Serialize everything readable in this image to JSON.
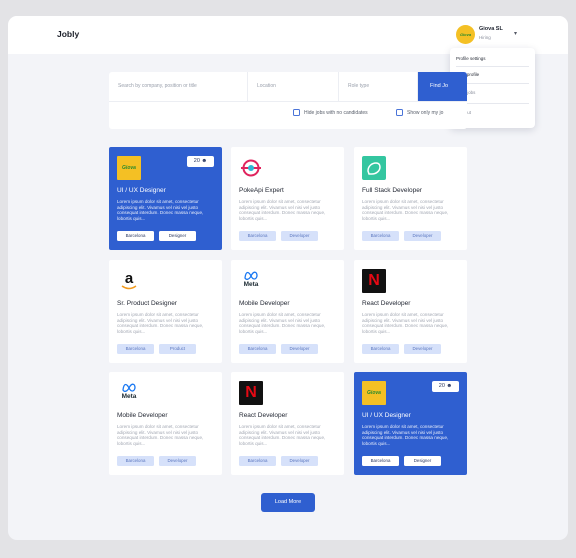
{
  "header": {
    "brand": "Jobly",
    "user": {
      "name": "Giova SL",
      "role": "Hiring",
      "avatar_text": "Giova"
    }
  },
  "dropdown": {
    "items": [
      "Profile settings",
      "View profile",
      "My jobs",
      "Log out"
    ]
  },
  "search": {
    "query_placeholder": "Search by company, position or title",
    "location_placeholder": "Location",
    "role_placeholder": "Role type",
    "button_label": "Find Jo",
    "checkbox_no_candidates": "Hide jobs with no candidates",
    "checkbox_only_my": "Show only my jo"
  },
  "cards": [
    {
      "title": "UI / UX Designer",
      "desc": "Lorem ipsum dolor sit amet, consectetur adipiscing elit. Vivamus vel nisi vel justo consequat interdum. Donec massa neque, lobortis quis...",
      "tags": [
        "Barcelona",
        "Designer"
      ],
      "count": "20",
      "logo": "giova",
      "highlight": true
    },
    {
      "title": "PokeApi Expert",
      "desc": "Lorem ipsum dolor sit amet, consectetur adipiscing elit. Vivamus vel nisi vel justo consequat interdum. Donec massa neque, lobortis quis...",
      "tags": [
        "Barcelona",
        "Developer"
      ],
      "logo": "pokeapi",
      "highlight": false
    },
    {
      "title": "Full Stack Developer",
      "desc": "Lorem ipsum dolor sit amet, consectetur adipiscing elit. Vivamus vel nisi vel justo consequat interdum. Donec massa neque, lobortis quis...",
      "tags": [
        "Barcelona",
        "Developer"
      ],
      "logo": "leaf",
      "highlight": false
    },
    {
      "title": "Sr. Product Designer",
      "desc": "Lorem ipsum dolor sit amet, consectetur adipiscing elit. Vivamus vel nisi vel justo consequat interdum. Donec massa neque, lobortis quis...",
      "tags": [
        "Barcelona",
        "Product"
      ],
      "logo": "amazon",
      "highlight": false
    },
    {
      "title": "Mobile Developer",
      "desc": "Lorem ipsum dolor sit amet, consectetur adipiscing elit. Vivamus vel nisi vel justo consequat interdum. Donec massa neque, lobortis quis...",
      "tags": [
        "Barcelona",
        "Developer"
      ],
      "logo": "meta",
      "highlight": false
    },
    {
      "title": "React Developer",
      "desc": "Lorem ipsum dolor sit amet, consectetur adipiscing elit. Vivamus vel nisi vel justo consequat interdum. Donec massa neque, lobortis quis...",
      "tags": [
        "Barcelona",
        "Developer"
      ],
      "logo": "netflix",
      "highlight": false
    },
    {
      "title": "Mobile Developer",
      "desc": "Lorem ipsum dolor sit amet, consectetur adipiscing elit. Vivamus vel nisi vel justo consequat interdum. Donec massa neque, lobortis quis...",
      "tags": [
        "Barcelona",
        "Developer"
      ],
      "logo": "meta",
      "highlight": false
    },
    {
      "title": "React Developer",
      "desc": "Lorem ipsum dolor sit amet, consectetur adipiscing elit. Vivamus vel nisi vel justo consequat interdum. Donec massa neque, lobortis quis...",
      "tags": [
        "Barcelona",
        "Developer"
      ],
      "logo": "netflix",
      "highlight": false
    },
    {
      "title": "UI / UX Designer",
      "desc": "Lorem ipsum dolor sit amet, consectetur adipiscing elit. Vivamus vel nisi vel justo consequat interdum. Donec massa neque, lobortis quis...",
      "tags": [
        "Barcelona",
        "Designer"
      ],
      "count": "20",
      "logo": "giova",
      "highlight": true
    }
  ],
  "logo_text": {
    "giova": "Giova",
    "amazon": "a",
    "meta": "Meta",
    "netflix": "N"
  },
  "load_more": "Load More",
  "colors": {
    "accent": "#2f5fd0",
    "tag_bg": "#d6e1fa",
    "netflix_red": "#e50914",
    "giova_yellow": "#f4c024"
  }
}
